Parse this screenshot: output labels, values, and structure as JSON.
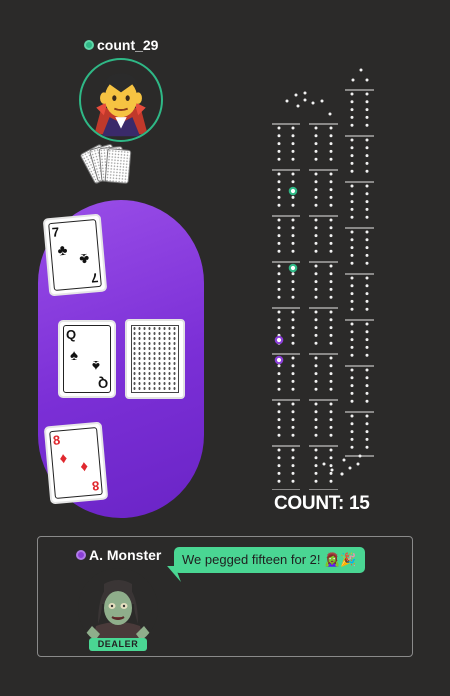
{
  "opponent": {
    "name": "count_29",
    "status": "online",
    "avatar_emoji": "🧛‍♂️",
    "hand_count": 4
  },
  "table": {
    "color": "#7b2fd6",
    "opponent_card": {
      "rank": "7",
      "suit": "♣",
      "color": "#111111"
    },
    "starter_card": {
      "rank": "Q",
      "suit": "♠",
      "color": "#111111"
    },
    "deck": "face-down",
    "player_card": {
      "rank": "8",
      "suit": "♦",
      "color": "#e0282e"
    }
  },
  "board": {
    "peg_colors": {
      "green": "#2fb886",
      "purple": "#8b3fd6"
    }
  },
  "count": {
    "label": "COUNT: 15"
  },
  "player": {
    "name": "A. Monster",
    "avatar_emoji": "🧟‍♀️",
    "badge": "DEALER",
    "message": "We pegged fifteen for 2! 🧟‍♀️🎉"
  }
}
